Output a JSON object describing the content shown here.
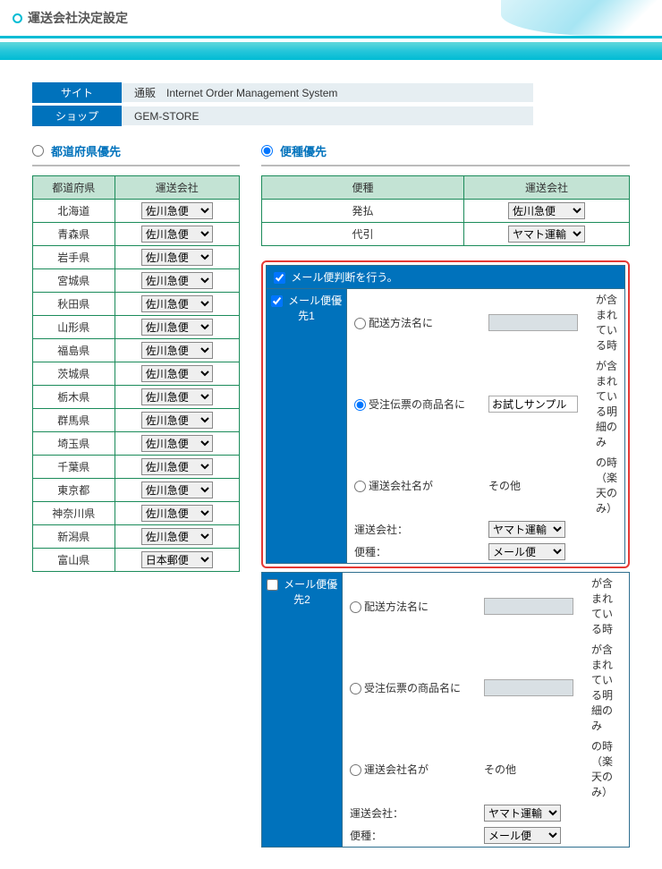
{
  "page_title": "運送会社決定設定",
  "meta": {
    "site_label": "サイト",
    "site_value": "通販　Internet Order Management System",
    "shop_label": "ショップ",
    "shop_value": "GEM-STORE"
  },
  "sections": {
    "prefecture_priority": "都道府県優先",
    "type_priority": "便種優先"
  },
  "pref_table": {
    "headers": {
      "pref": "都道府県",
      "carrier": "運送会社"
    },
    "rows": [
      {
        "pref": "北海道",
        "carrier": "佐川急便"
      },
      {
        "pref": "青森県",
        "carrier": "佐川急便"
      },
      {
        "pref": "岩手県",
        "carrier": "佐川急便"
      },
      {
        "pref": "宮城県",
        "carrier": "佐川急便"
      },
      {
        "pref": "秋田県",
        "carrier": "佐川急便"
      },
      {
        "pref": "山形県",
        "carrier": "佐川急便"
      },
      {
        "pref": "福島県",
        "carrier": "佐川急便"
      },
      {
        "pref": "茨城県",
        "carrier": "佐川急便"
      },
      {
        "pref": "栃木県",
        "carrier": "佐川急便"
      },
      {
        "pref": "群馬県",
        "carrier": "佐川急便"
      },
      {
        "pref": "埼玉県",
        "carrier": "佐川急便"
      },
      {
        "pref": "千葉県",
        "carrier": "佐川急便"
      },
      {
        "pref": "東京都",
        "carrier": "佐川急便"
      },
      {
        "pref": "神奈川県",
        "carrier": "佐川急便"
      },
      {
        "pref": "新潟県",
        "carrier": "佐川急便"
      },
      {
        "pref": "富山県",
        "carrier": "日本郵便"
      }
    ]
  },
  "type_table": {
    "headers": {
      "type": "便種",
      "carrier": "運送会社"
    },
    "rows": [
      {
        "type": "発払",
        "carrier": "佐川急便"
      },
      {
        "type": "代引",
        "carrier": "ヤマト運輸"
      }
    ]
  },
  "mail_rules": {
    "flag_label": "メール便判断を行う。",
    "labels": {
      "priority1": "メール便優先1",
      "priority2": "メール便優先2",
      "by_shipping": "配送方法名に",
      "by_product": "受注伝票の商品名に",
      "by_company": "運送会社名が",
      "carrier": "運送会社：",
      "type": "便種：",
      "contains_when": "が含まれている時",
      "contains_detail": "が含まれている明細のみ",
      "when_rakuten": "の時（楽天のみ）",
      "other": "その他",
      "sample_text": "お試しサンプル"
    },
    "selects": {
      "carrier_value": "ヤマト運輸",
      "type_value": "メール便"
    }
  }
}
